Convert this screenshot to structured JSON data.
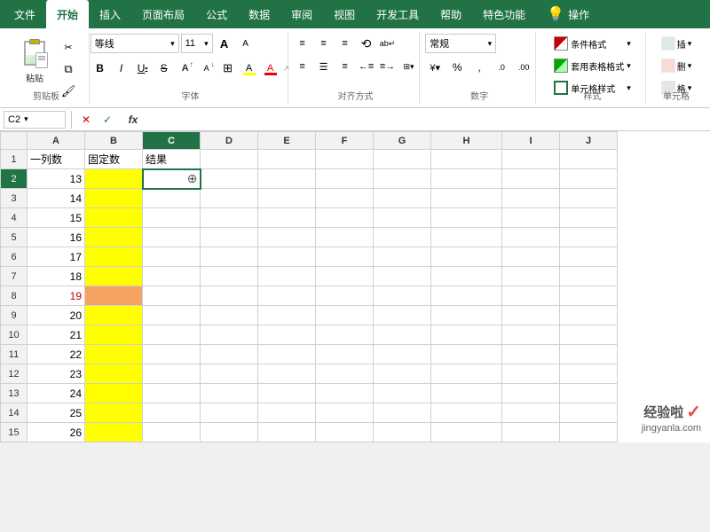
{
  "ribbon": {
    "tabs": [
      "文件",
      "开始",
      "插入",
      "页面布局",
      "公式",
      "数据",
      "审阅",
      "视图",
      "开发工具",
      "帮助",
      "特色功能",
      "操作"
    ],
    "active_tab": "开始",
    "groups": {
      "clipboard": {
        "label": "剪贴板",
        "paste": "粘贴",
        "cut": "✂",
        "copy": "⧉",
        "format_painter": "🖌"
      },
      "font": {
        "label": "字体",
        "font_name": "等线",
        "font_size": "11",
        "bold": "B",
        "italic": "I",
        "underline": "U",
        "strikethrough": "S",
        "increase": "A",
        "decrease": "a",
        "border": "⊞",
        "fill_color": "A",
        "font_color": "A"
      },
      "alignment": {
        "label": "对齐方式",
        "top_left": "≡",
        "top_center": "≡",
        "top_right": "≡",
        "mid_left": "≡",
        "mid_center": "≡",
        "mid_right": "≡",
        "wrap": "ab",
        "merge": "⊞",
        "indent_left": "←",
        "indent_right": "→",
        "orientation": "⟲"
      },
      "number": {
        "label": "数字",
        "format": "常规",
        "currency": "¥",
        "percent": "%",
        "comma": ",",
        "increase_decimal": ".0",
        "decrease_decimal": ".00"
      },
      "styles": {
        "label": "样式",
        "conditional": "条件格式",
        "table_format": "套用表格格式",
        "cell_styles": "单元格样式"
      },
      "cells": {
        "label": "单元格",
        "insert": "插",
        "delete": "删",
        "format": "格"
      }
    }
  },
  "formula_bar": {
    "cell_ref": "C2",
    "cancel": "✕",
    "confirm": "✓",
    "fx": "fx",
    "formula": ""
  },
  "spreadsheet": {
    "col_headers": [
      "",
      "A",
      "B",
      "C",
      "D",
      "E",
      "F",
      "G",
      "H",
      "I",
      "J"
    ],
    "rows": [
      {
        "row": 1,
        "cells": [
          "一列数",
          "固定数",
          "结果",
          "",
          "",
          "",
          "",
          "",
          "",
          ""
        ]
      },
      {
        "row": 2,
        "cells": [
          "13",
          "",
          "",
          "",
          "",
          "",
          "",
          "",
          "",
          ""
        ]
      },
      {
        "row": 3,
        "cells": [
          "14",
          "",
          "",
          "",
          "",
          "",
          "",
          "",
          "",
          ""
        ]
      },
      {
        "row": 4,
        "cells": [
          "15",
          "",
          "",
          "",
          "",
          "",
          "",
          "",
          "",
          ""
        ]
      },
      {
        "row": 5,
        "cells": [
          "16",
          "",
          "",
          "",
          "",
          "",
          "",
          "",
          "",
          ""
        ]
      },
      {
        "row": 6,
        "cells": [
          "17",
          "",
          "",
          "",
          "",
          "",
          "",
          "",
          "",
          ""
        ]
      },
      {
        "row": 7,
        "cells": [
          "18",
          "",
          "",
          "",
          "",
          "",
          "",
          "",
          "",
          ""
        ]
      },
      {
        "row": 8,
        "cells": [
          "19",
          "",
          "",
          "",
          "",
          "",
          "",
          "",
          "",
          ""
        ]
      },
      {
        "row": 9,
        "cells": [
          "20",
          "",
          "",
          "",
          "",
          "",
          "",
          "",
          "",
          ""
        ]
      },
      {
        "row": 10,
        "cells": [
          "21",
          "",
          "",
          "",
          "",
          "",
          "",
          "",
          "",
          ""
        ]
      },
      {
        "row": 11,
        "cells": [
          "22",
          "",
          "",
          "",
          "",
          "",
          "",
          "",
          "",
          ""
        ]
      },
      {
        "row": 12,
        "cells": [
          "23",
          "",
          "",
          "",
          "",
          "",
          "",
          "",
          "",
          ""
        ]
      },
      {
        "row": 13,
        "cells": [
          "24",
          "",
          "",
          "",
          "",
          "",
          "",
          "",
          "",
          ""
        ]
      },
      {
        "row": 14,
        "cells": [
          "25",
          "",
          "",
          "",
          "",
          "",
          "",
          "",
          "",
          ""
        ]
      },
      {
        "row": 15,
        "cells": [
          "26",
          "",
          "",
          "",
          "",
          "",
          "",
          "",
          "",
          ""
        ]
      }
    ],
    "active_cell": "C2",
    "active_col": "C",
    "active_row": 2
  },
  "watermark": {
    "site": "经验啦",
    "url": "jingyanla.com",
    "check": "✓"
  },
  "colors": {
    "ribbon_green": "#217346",
    "yellow": "#ffff00",
    "salmon": "#e9967a",
    "selected_border": "#217346"
  }
}
